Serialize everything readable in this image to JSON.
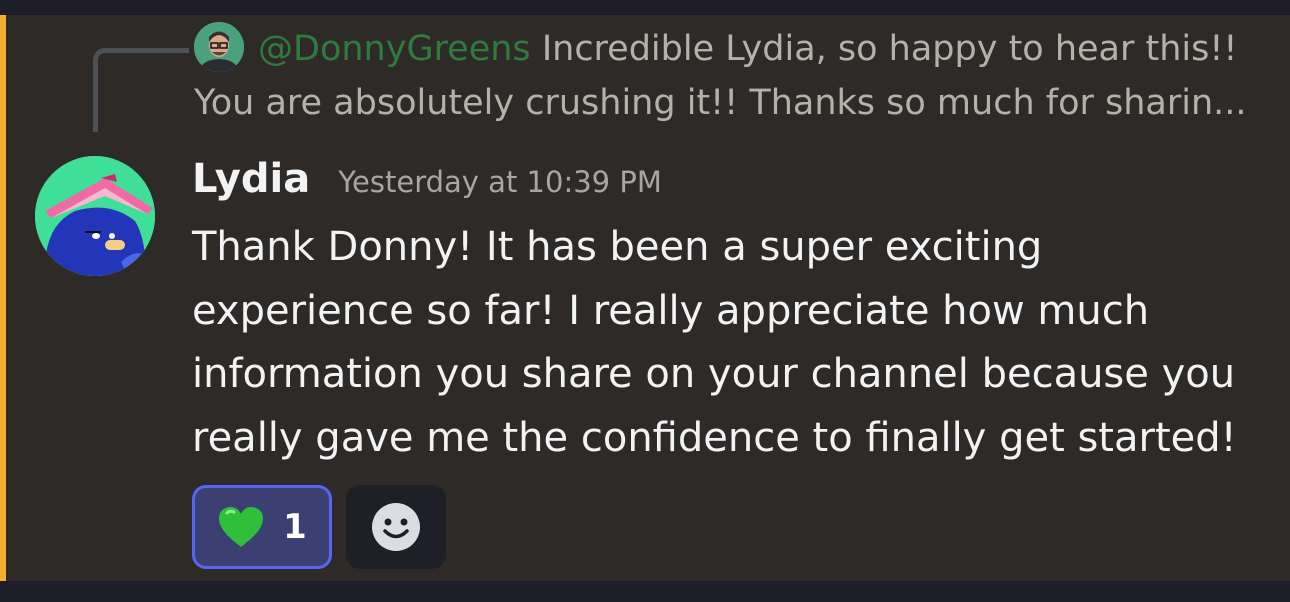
{
  "reply": {
    "author": "@DonnyGreens",
    "line1": "Incredible Lydia, so happy to hear this!!",
    "line2": "You are absolutely crushing it!! Thanks so much for sharin..."
  },
  "message": {
    "username": "Lydia",
    "timestamp": "Yesterday at 10:39 PM",
    "lines": [
      "Thank Donny! It has been a super exciting",
      "experience so far! I really appreciate how much",
      "information you share on your channel because you",
      "really gave me the confidence to finally get started!"
    ]
  },
  "reactions": [
    {
      "icon": "green-heart-icon",
      "count": "1"
    }
  ],
  "colors": {
    "accent_bar": "#f0b132",
    "reply_author": "#2f7a3d",
    "reaction_border": "#5865f2"
  }
}
